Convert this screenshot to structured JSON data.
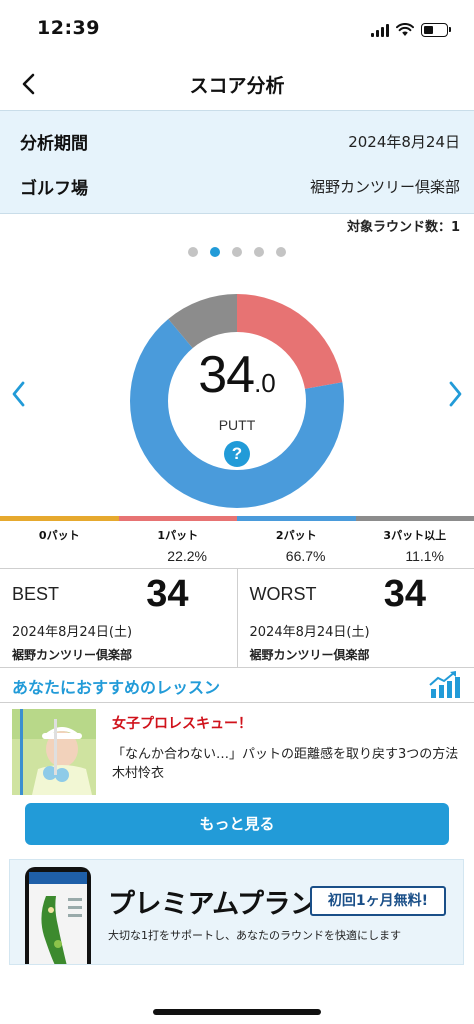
{
  "status_bar": {
    "time": "12:39"
  },
  "nav": {
    "title": "スコア分析"
  },
  "period": {
    "period_label": "分析期間",
    "period_value": "2024年8月24日",
    "course_label": "ゴルフ場",
    "course_value": "裾野カンツリー倶楽部"
  },
  "round_count": "対象ラウンド数：1",
  "score": {
    "integer": "34",
    "decimal": ".0",
    "unit": "PUTT",
    "help": "?"
  },
  "chart_data": {
    "type": "pie",
    "categories": [
      "0パット",
      "1パット",
      "2パット",
      "3パット以上"
    ],
    "values": [
      0,
      22.2,
      66.7,
      11.1
    ],
    "colors": [
      "#e6a92e",
      "#e77373",
      "#4a9bdb",
      "#8c8c8c"
    ],
    "center_value": "34.0",
    "center_label": "PUTT"
  },
  "putt_breakdown": [
    {
      "label": "0パット",
      "pct": ""
    },
    {
      "label": "1パット",
      "pct": "22.2%"
    },
    {
      "label": "2パット",
      "pct": "66.7%"
    },
    {
      "label": "3パット以上",
      "pct": "11.1%"
    }
  ],
  "best": {
    "label": "BEST",
    "score": "34",
    "date": "2024年8月24日(土)",
    "course": "裾野カンツリー倶楽部"
  },
  "worst": {
    "label": "WORST",
    "score": "34",
    "date": "2024年8月24日(土)",
    "course": "裾野カンツリー倶楽部"
  },
  "lesson": {
    "section_title": "あなたにおすすめのレッスン",
    "tag": "女子プロレスキュー！",
    "description": "「なんか合わない…」パットの距離感を取り戻す3つの方法 木村怜衣",
    "more_label": "もっと見る"
  },
  "premium": {
    "title": "プレミアムプラン",
    "badge": "初回1ヶ月無料!",
    "subtitle": "大切な1打をサポートし、あなたのラウンドを快適にします"
  }
}
